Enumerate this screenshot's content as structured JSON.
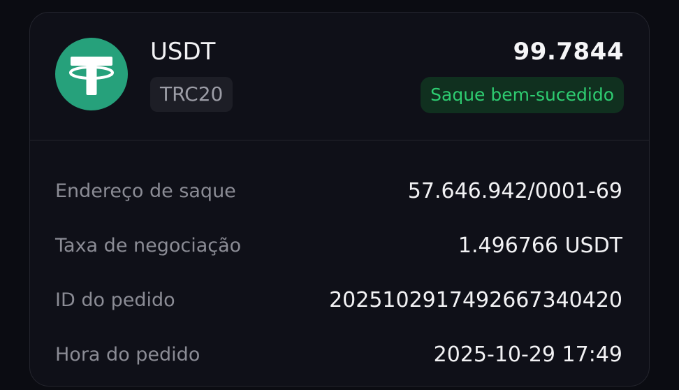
{
  "asset": {
    "name": "USDT",
    "network": "TRC20",
    "amount": "99.7844",
    "status": "Saque bem-sucedido",
    "logo_icon": "tether-icon",
    "logo_color": "#26a17b",
    "status_color": "#2ecc71"
  },
  "details": [
    {
      "label": "Endereço de saque",
      "value": "57.646.942/0001-69"
    },
    {
      "label": "Taxa de negociação",
      "value": "1.496766 USDT"
    },
    {
      "label": "ID do pedido",
      "value": "2025102917492667340420"
    },
    {
      "label": "Hora do pedido",
      "value": "2025-10-29 17:49"
    }
  ]
}
